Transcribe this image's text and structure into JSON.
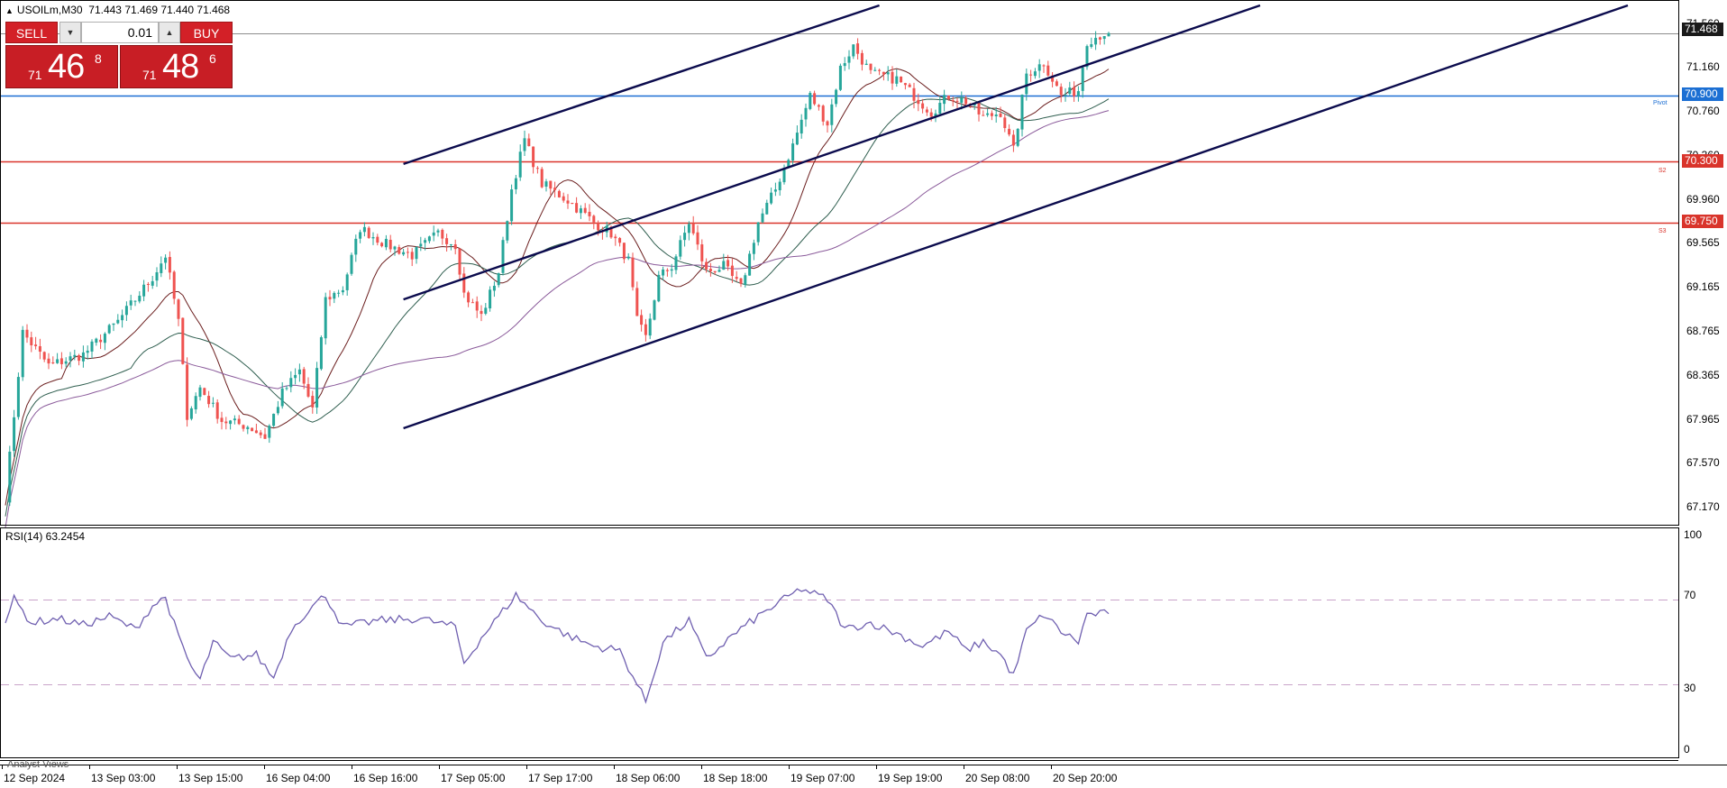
{
  "header": {
    "symbol_line": "USOILm,M30",
    "ohlc": "71.443 71.469 71.440 71.468"
  },
  "trade_panel": {
    "sell_label": "SELL",
    "buy_label": "BUY",
    "volume": "0.01",
    "bid": {
      "prefix": "71",
      "big": "46",
      "sup": "8"
    },
    "ask": {
      "prefix": "71",
      "big": "48",
      "sup": "6"
    }
  },
  "price_tags": {
    "current": "71.468",
    "pivot": "70.900",
    "s2": "70.300",
    "s3": "69.750"
  },
  "level_labels": {
    "pivot": "Pivot",
    "s2": "S2",
    "s3": "S3"
  },
  "rsi": {
    "label": "RSI(14) 63.2454",
    "ticks": [
      "100",
      "70",
      "30",
      "0"
    ]
  },
  "footer": {
    "analyst_views": "Analyst Views"
  },
  "colors": {
    "bull_candle": "#26a69a",
    "bear_candle": "#ef5350",
    "pivot_line": "#1c6fd3",
    "support_line": "#d9342b",
    "channel_line": "#0b0b4d",
    "rsi_line": "#6f5fb0",
    "ma_fast": "#6b1e1e",
    "ma_mid": "#2f5e4f",
    "ma_slow": "#8a5a9a"
  },
  "chart_data": {
    "type": "candlestick",
    "y_ticks": [
      71.56,
      71.16,
      70.76,
      70.36,
      69.96,
      69.565,
      69.165,
      68.765,
      68.365,
      67.965,
      67.57,
      67.17
    ],
    "ylim": [
      67.02,
      71.72
    ],
    "x_ticks": [
      "12 Sep 2024",
      "13 Sep 03:00",
      "13 Sep 15:00",
      "16 Sep 04:00",
      "16 Sep 16:00",
      "17 Sep 05:00",
      "17 Sep 17:00",
      "18 Sep 06:00",
      "18 Sep 18:00",
      "19 Sep 07:00",
      "19 Sep 19:00",
      "20 Sep 08:00",
      "20 Sep 20:00"
    ],
    "horizontal_levels": [
      {
        "name": "current",
        "price": 71.468
      },
      {
        "name": "pivot",
        "price": 70.9
      },
      {
        "name": "s2",
        "price": 70.3
      },
      {
        "name": "s3",
        "price": 69.75
      }
    ],
    "close_path": [
      [
        0,
        67.25
      ],
      [
        4,
        68.75
      ],
      [
        10,
        68.45
      ],
      [
        18,
        68.55
      ],
      [
        26,
        68.85
      ],
      [
        34,
        69.25
      ],
      [
        37,
        69.45
      ],
      [
        40,
        68.85
      ],
      [
        42,
        68.0
      ],
      [
        45,
        68.25
      ],
      [
        50,
        67.95
      ],
      [
        56,
        67.9
      ],
      [
        60,
        67.8
      ],
      [
        64,
        68.2
      ],
      [
        68,
        68.4
      ],
      [
        71,
        68.05
      ],
      [
        74,
        69.05
      ],
      [
        78,
        69.15
      ],
      [
        82,
        69.7
      ],
      [
        88,
        69.55
      ],
      [
        94,
        69.45
      ],
      [
        100,
        69.65
      ],
      [
        104,
        69.55
      ],
      [
        106,
        69.1
      ],
      [
        110,
        68.9
      ],
      [
        114,
        69.3
      ],
      [
        117,
        70.05
      ],
      [
        120,
        70.5
      ],
      [
        124,
        70.1
      ],
      [
        130,
        69.95
      ],
      [
        136,
        69.75
      ],
      [
        140,
        69.65
      ],
      [
        144,
        69.4
      ],
      [
        146,
        68.85
      ],
      [
        148,
        68.7
      ],
      [
        151,
        69.25
      ],
      [
        154,
        69.35
      ],
      [
        158,
        69.75
      ],
      [
        162,
        69.3
      ],
      [
        166,
        69.35
      ],
      [
        170,
        69.15
      ],
      [
        174,
        69.75
      ],
      [
        178,
        70.05
      ],
      [
        182,
        70.45
      ],
      [
        186,
        70.9
      ],
      [
        190,
        70.65
      ],
      [
        193,
        71.15
      ],
      [
        196,
        71.35
      ],
      [
        200,
        71.1
      ],
      [
        206,
        71.05
      ],
      [
        210,
        70.9
      ],
      [
        214,
        70.75
      ],
      [
        218,
        70.9
      ],
      [
        222,
        70.85
      ],
      [
        226,
        70.7
      ],
      [
        230,
        70.75
      ],
      [
        233,
        70.4
      ],
      [
        236,
        71.1
      ],
      [
        240,
        71.2
      ],
      [
        244,
        70.9
      ],
      [
        248,
        70.95
      ],
      [
        250,
        71.4
      ],
      [
        254,
        71.468
      ]
    ],
    "channel_lines": [
      {
        "from": [
          92,
          70.28
        ],
        "to": [
          202,
          71.72
        ]
      },
      {
        "from": [
          92,
          69.05
        ],
        "to": [
          290,
          71.72
        ]
      },
      {
        "from": [
          92,
          67.88
        ],
        "to": [
          375,
          71.72
        ]
      }
    ],
    "rsi": {
      "period": 14,
      "current": 63.2454,
      "ylim": [
        0,
        100
      ],
      "levels": [
        70,
        30
      ],
      "path": [
        [
          0,
          60
        ],
        [
          2,
          70
        ],
        [
          6,
          59
        ],
        [
          12,
          61
        ],
        [
          18,
          58
        ],
        [
          24,
          62
        ],
        [
          30,
          56
        ],
        [
          34,
          67
        ],
        [
          37,
          71
        ],
        [
          40,
          52
        ],
        [
          43,
          38
        ],
        [
          45,
          32
        ],
        [
          48,
          50
        ],
        [
          52,
          42
        ],
        [
          58,
          44
        ],
        [
          62,
          33
        ],
        [
          66,
          56
        ],
        [
          70,
          65
        ],
        [
          74,
          72
        ],
        [
          78,
          57
        ],
        [
          86,
          60
        ],
        [
          96,
          61
        ],
        [
          104,
          57
        ],
        [
          106,
          40
        ],
        [
          110,
          52
        ],
        [
          114,
          62
        ],
        [
          118,
          72
        ],
        [
          124,
          60
        ],
        [
          130,
          53
        ],
        [
          136,
          48
        ],
        [
          142,
          46
        ],
        [
          146,
          30
        ],
        [
          148,
          22
        ],
        [
          152,
          50
        ],
        [
          158,
          60
        ],
        [
          162,
          42
        ],
        [
          168,
          53
        ],
        [
          174,
          62
        ],
        [
          180,
          70
        ],
        [
          184,
          75
        ],
        [
          190,
          70
        ],
        [
          194,
          56
        ],
        [
          200,
          59
        ],
        [
          206,
          54
        ],
        [
          212,
          48
        ],
        [
          218,
          55
        ],
        [
          222,
          46
        ],
        [
          226,
          50
        ],
        [
          230,
          44
        ],
        [
          233,
          34
        ],
        [
          236,
          55
        ],
        [
          240,
          63
        ],
        [
          244,
          55
        ],
        [
          248,
          50
        ],
        [
          250,
          63
        ],
        [
          254,
          63.2454
        ]
      ]
    }
  }
}
